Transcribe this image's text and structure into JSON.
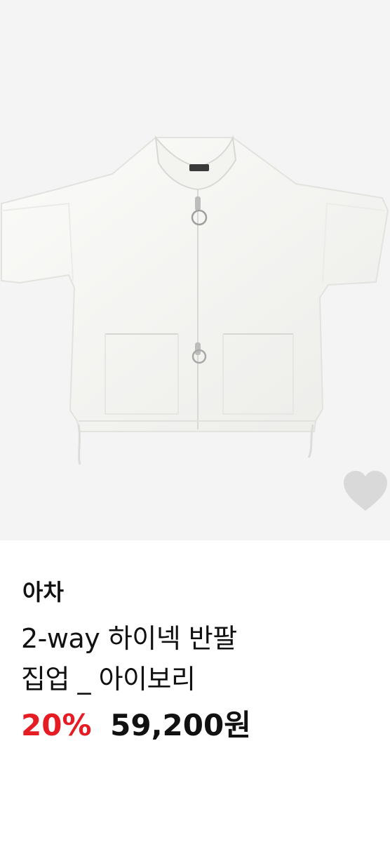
{
  "product": {
    "image_alt": "2-way 하이넥 반팔 집업 _ 아이보리",
    "brand": "아차",
    "title_line1": "2-way 하이넥 반팔",
    "title_line2": "집업 _ 아이보리",
    "discount": "20%",
    "price": "59,200원"
  },
  "wishlist": {
    "icon": "heart-icon",
    "color": "#d9d9d9"
  },
  "colors": {
    "discount": "#e51c23",
    "text": "#111111",
    "image_bg": "#f4f4f4"
  }
}
